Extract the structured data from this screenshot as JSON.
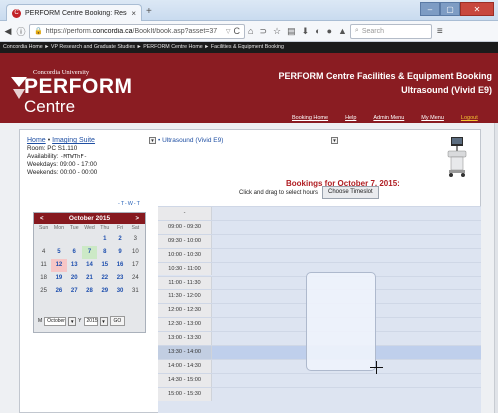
{
  "browser": {
    "tab_title": "PERFORM Centre Booking: Reserv...",
    "url_domain": "https://perform.",
    "url_bold": "concordia.ca",
    "url_path": "/BookIt/book.asp?asset=37",
    "search_placeholder": "Search"
  },
  "site": {
    "breadcrumb": "Concordia Home  ►  VP Research and Graduate Studies  ►  PERFORM Centre Home  ►  Facilities & Equipment Booking",
    "university": "Concordia University",
    "logo_name": "PERFORM",
    "logo_sub": "Centre",
    "title_line1": "PERFORM Centre Facilities & Equipment Booking",
    "title_line2": "Ultrasound (Vivid E9)",
    "nav": [
      "Booking Home",
      "Help",
      "Admin Menu",
      "My Menu",
      "Logout"
    ]
  },
  "asset": {
    "home_link": "Home",
    "suite_link": "Imaging Suite",
    "room": "Room: PC S1.110",
    "availability_label": "Availability: ",
    "availability_days": "-MTWThF-",
    "weekdays": "Weekdays: 09:00 - 17:00",
    "weekends": "Weekends: 00:00 - 00:00",
    "resource_link": "Ultrasound (Vivid E9)"
  },
  "calendar": {
    "mini_tools": "-T-W-T",
    "month_title": "October 2015",
    "prev": "<",
    "next": ">",
    "day_names": [
      "Sun",
      "Mon",
      "Tue",
      "Wed",
      "Thu",
      "Fri",
      "Sat"
    ],
    "weeks": [
      [
        "",
        "",
        "",
        "",
        "1",
        "2",
        "3"
      ],
      [
        "4",
        "5",
        "6",
        "7",
        "8",
        "9",
        "10"
      ],
      [
        "11",
        "12",
        "13",
        "14",
        "15",
        "16",
        "17"
      ],
      [
        "18",
        "19",
        "20",
        "21",
        "22",
        "23",
        "24"
      ],
      [
        "25",
        "26",
        "27",
        "28",
        "29",
        "30",
        "31"
      ]
    ],
    "today": "12",
    "selected": "7",
    "month_label": "M",
    "month_value": "October",
    "year_label": "Y",
    "year_value": "2015",
    "go": "GO"
  },
  "bookings": {
    "title": "Bookings for October 7, 2015:",
    "hint": "Click and drag to select hours",
    "choose_button": "Choose Timeslot",
    "header_label": "-",
    "slots": [
      "09:00 - 09:30",
      "09:30 - 10:00",
      "10:00 - 10:30",
      "10:30 - 11:00",
      "11:00 - 11:30",
      "11:30 - 12:00",
      "12:00 - 12:30",
      "12:30 - 13:00",
      "13:00 - 13:30",
      "13:30 - 14:00",
      "14:00 - 14:30",
      "14:30 - 15:00",
      "15:00 - 15:30"
    ],
    "highlighted_slot": "13:30 - 14:00"
  }
}
